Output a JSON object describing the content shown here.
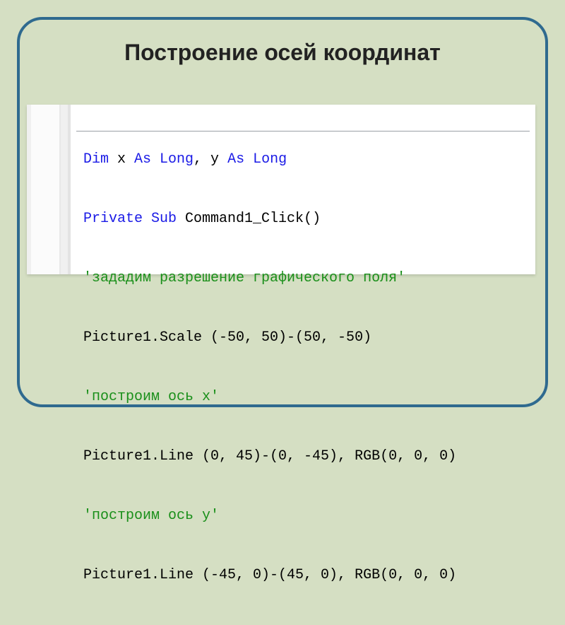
{
  "title": "Построение осей координат",
  "code": {
    "l1_kw1": "Dim",
    "l1_var1": " x ",
    "l1_kw2": "As Long",
    "l1_comma": ", y ",
    "l1_kw3": "As Long",
    "l2_kw1": "Private Sub",
    "l2_name": " Command1_Click()",
    "l3_comment": "'зададим разрешение графического поля'",
    "l4": "Picture1.Scale (-50, 50)-(50, -50)",
    "l5_comment": "'построим ось x'",
    "l6": "Picture1.Line (0, 45)-(0, -45), RGB(0, 0, 0)",
    "l7_comment": "'построим ось y'",
    "l8": "Picture1.Line (-45, 0)-(45, 0), RGB(0, 0, 0)"
  }
}
